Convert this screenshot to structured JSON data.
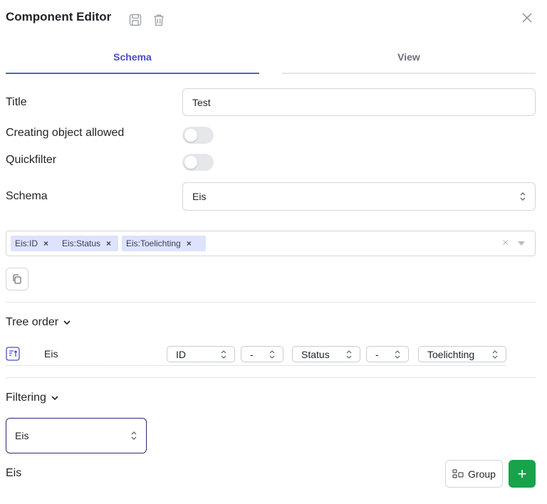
{
  "header": {
    "title": "Component Editor",
    "icons": [
      "save-icon",
      "trash-icon",
      "close-icon"
    ]
  },
  "tabs": [
    {
      "label": "Schema",
      "active": true
    },
    {
      "label": "View",
      "active": false
    }
  ],
  "form": {
    "title_label": "Title",
    "title_value": "Test",
    "creating_label": "Creating object allowed",
    "creating_on": false,
    "quickfilter_label": "Quickfilter",
    "quickfilter_on": false,
    "schema_label": "Schema",
    "schema_value": "Eis"
  },
  "fields": {
    "chips": [
      "Eis:ID",
      "Eis:Status",
      "Eis:Toelichting"
    ],
    "remove_glyph": "×",
    "clear_glyph": "×"
  },
  "tree_order": {
    "label": "Tree order",
    "row": {
      "name": "Eis",
      "selects": [
        "ID",
        "-",
        "Status",
        "-",
        "Toelichting"
      ]
    }
  },
  "filtering": {
    "label": "Filtering",
    "select_value": "Eis",
    "group_label": "Eis",
    "group_button": "Group",
    "add_glyph": "+"
  },
  "colors": {
    "accent": "#5b5ec7",
    "chip_bg": "#dde3fb",
    "add_green": "#16a34a"
  }
}
